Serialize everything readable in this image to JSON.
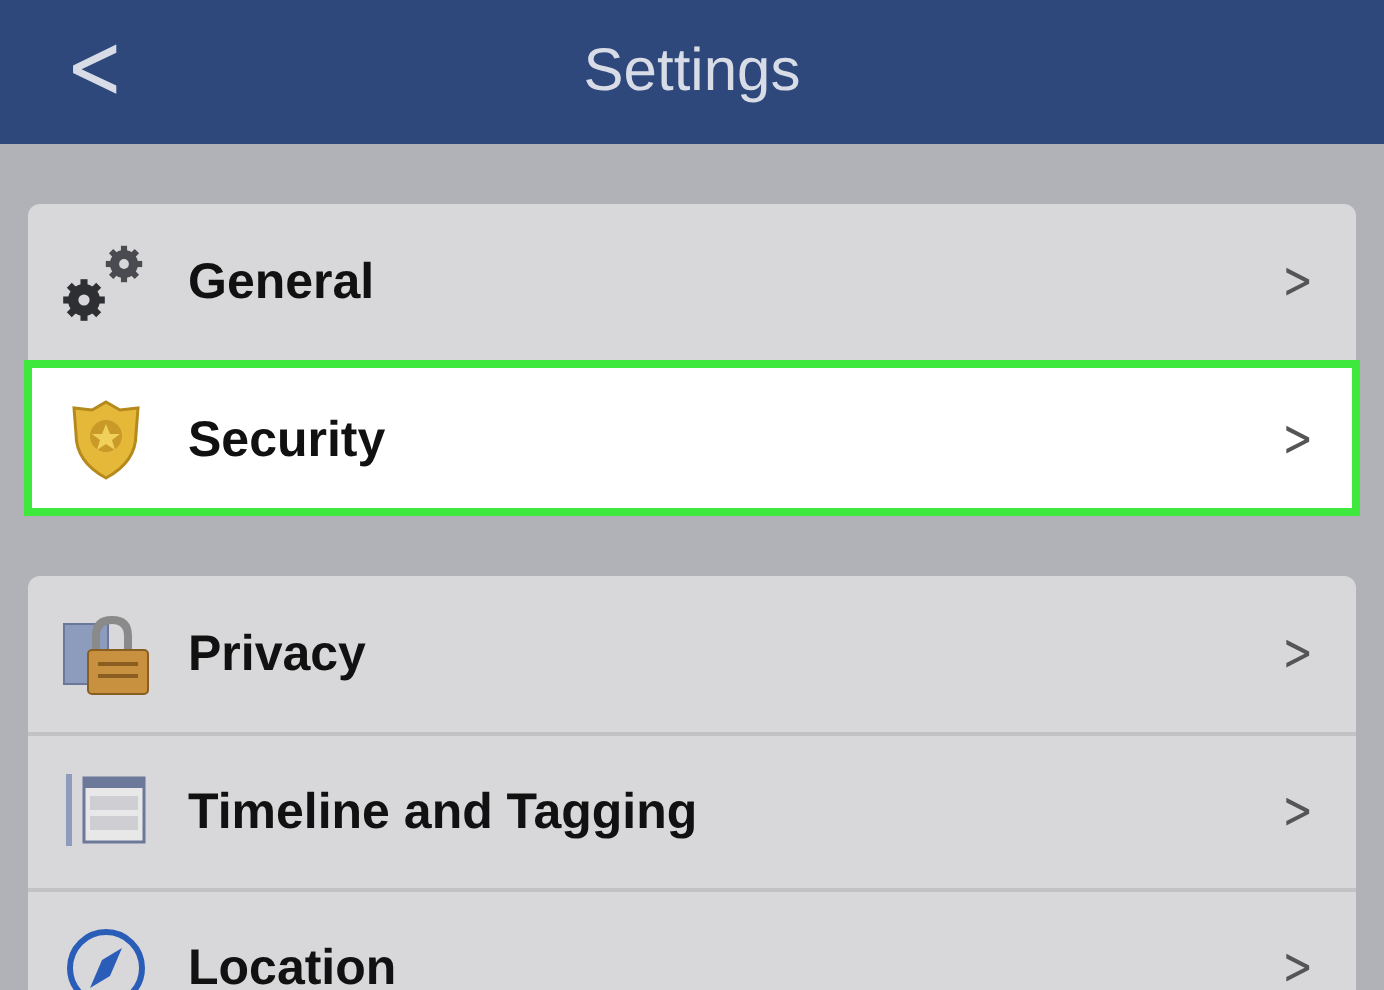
{
  "header": {
    "back": "<",
    "title": "Settings"
  },
  "sections": [
    {
      "items": [
        {
          "label": "General",
          "chevron": ">",
          "highlighted": false
        },
        {
          "label": "Security",
          "chevron": ">",
          "highlighted": true
        }
      ]
    },
    {
      "items": [
        {
          "label": "Privacy",
          "chevron": ">",
          "highlighted": false
        },
        {
          "label": "Timeline and Tagging",
          "chevron": ">",
          "highlighted": false
        },
        {
          "label": "Location",
          "chevron": ">",
          "highlighted": false
        }
      ]
    }
  ]
}
